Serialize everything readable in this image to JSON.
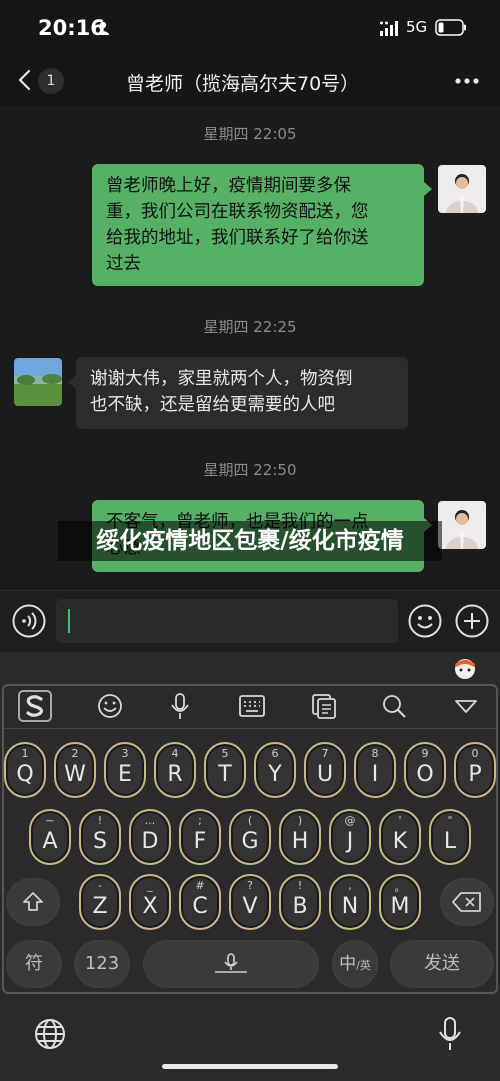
{
  "status_bar": {
    "time": "20:16",
    "network": "5G"
  },
  "nav": {
    "back_count": "1",
    "title": "曾老师（揽海高尔夫70号）"
  },
  "chat": {
    "messages": [
      {
        "time": "星期四 22:05",
        "direction": "out",
        "lines": [
          "曾老师晚上好，疫情期间要多保",
          "重，我们公司在联系物资配送，您",
          "给我的地址，我们联系好了给你送",
          "过去"
        ]
      },
      {
        "time": "星期四 22:25",
        "direction": "in",
        "lines": [
          "谢谢大伟，家里就两个人，物资倒",
          "也不缺，还是留给更需要的人吧"
        ]
      },
      {
        "time": "星期四 22:50",
        "direction": "out",
        "lines": [
          "不客气，曾老师，也是我们的一点",
          "心意"
        ]
      }
    ]
  },
  "overlay_caption": "绥化疫情地区包裹/绥化市疫情",
  "keyboard": {
    "toolbar_icons": [
      "sogou-logo",
      "emoji-icon",
      "microphone-icon",
      "keyboard-icon",
      "clipboard-icon",
      "search-icon",
      "collapse-icon"
    ],
    "rows": [
      [
        {
          "sub": "1",
          "key": "Q"
        },
        {
          "sub": "2",
          "key": "W"
        },
        {
          "sub": "3",
          "key": "E"
        },
        {
          "sub": "4",
          "key": "R"
        },
        {
          "sub": "5",
          "key": "T"
        },
        {
          "sub": "6",
          "key": "Y"
        },
        {
          "sub": "7",
          "key": "U"
        },
        {
          "sub": "8",
          "key": "I"
        },
        {
          "sub": "9",
          "key": "O"
        },
        {
          "sub": "0",
          "key": "P"
        }
      ],
      [
        {
          "sub": "~",
          "key": "A"
        },
        {
          "sub": "!",
          "key": "S"
        },
        {
          "sub": "...",
          "key": "D"
        },
        {
          "sub": ";",
          "key": "F"
        },
        {
          "sub": "(",
          "key": "G"
        },
        {
          "sub": ")",
          "key": "H"
        },
        {
          "sub": "@",
          "key": "J"
        },
        {
          "sub": "'",
          "key": "K"
        },
        {
          "sub": "\"",
          "key": "L"
        }
      ],
      [
        {
          "sub": "-",
          "key": "Z"
        },
        {
          "sub": "_",
          "key": "X"
        },
        {
          "sub": "#",
          "key": "C"
        },
        {
          "sub": "?",
          "key": "V"
        },
        {
          "sub": "!",
          "key": "B"
        },
        {
          "sub": ",",
          "key": "N"
        },
        {
          "sub": "。",
          "key": "M"
        }
      ]
    ],
    "symbols_label": "符",
    "numbers_label": "123",
    "lang_label_main": "中",
    "lang_label_sub": "/英",
    "send_label": "发送"
  }
}
